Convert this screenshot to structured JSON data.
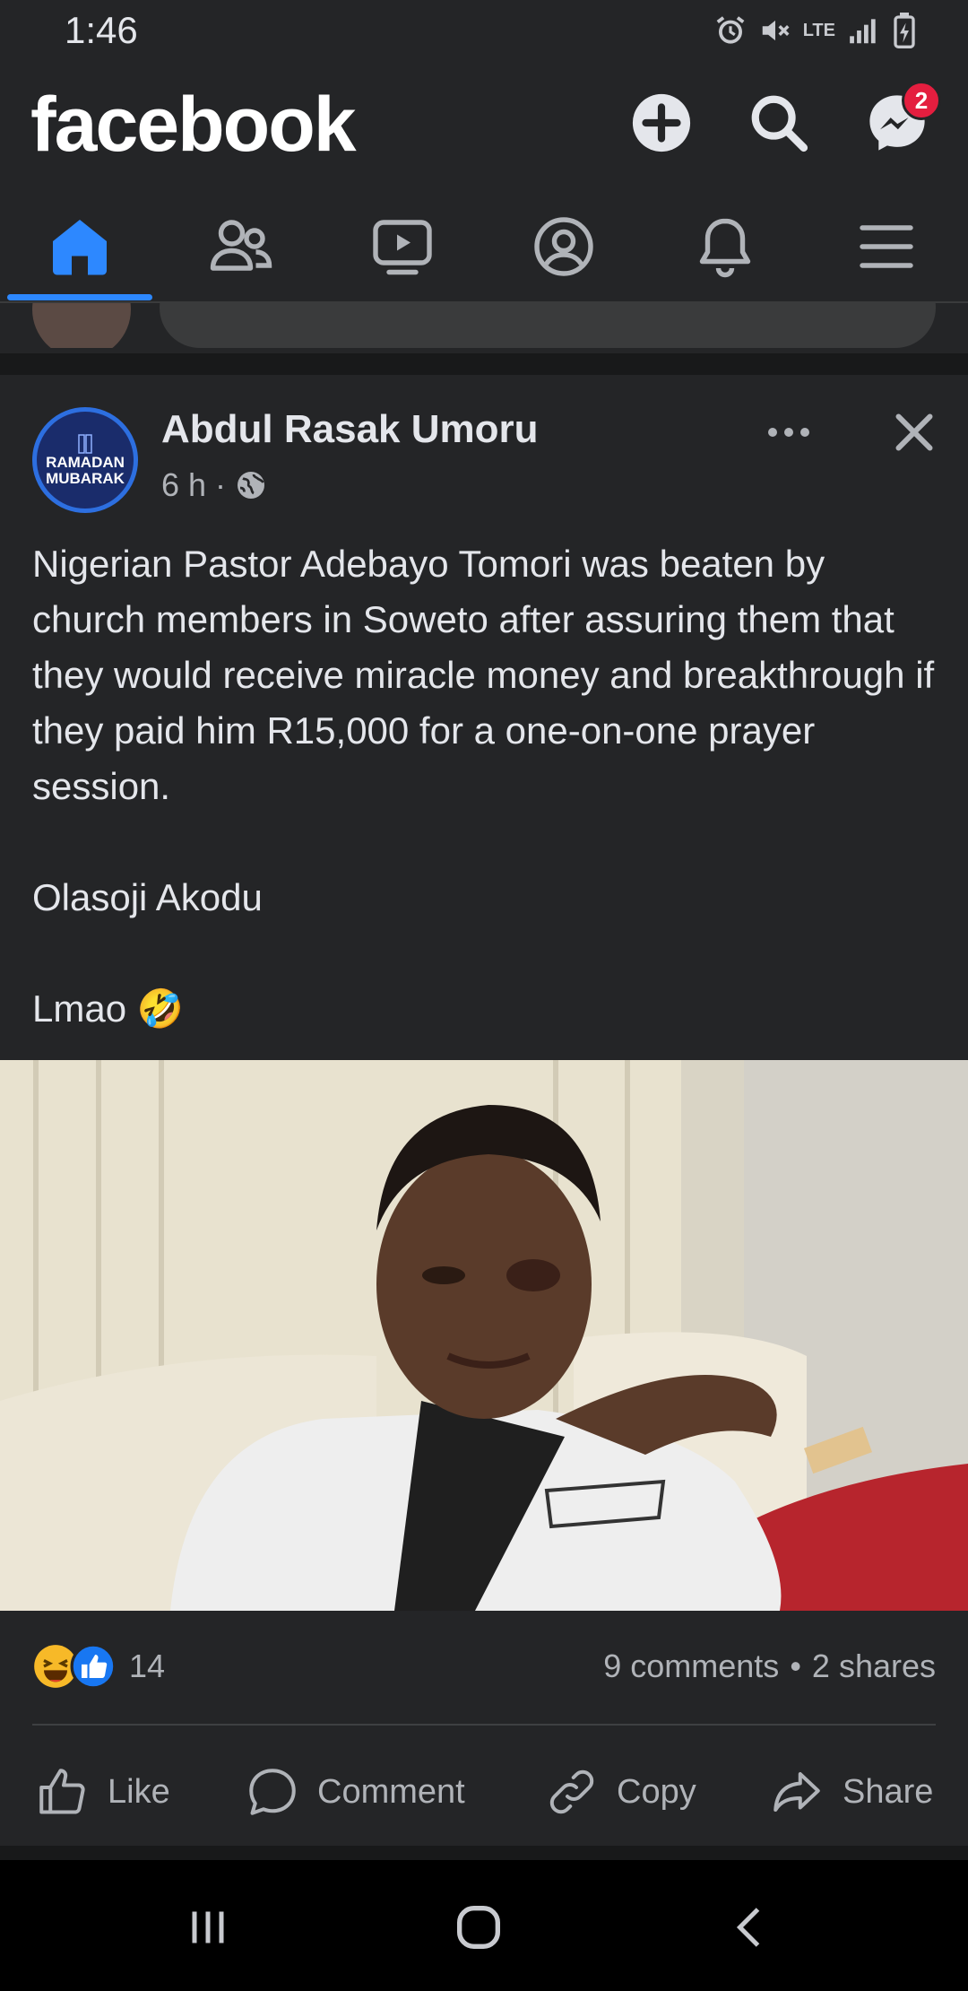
{
  "status_bar": {
    "time": "1:46",
    "network": "LTE"
  },
  "app": {
    "logo": "facebook",
    "messenger_badge": "2"
  },
  "nav_tabs": [
    {
      "name": "home",
      "icon": "home-icon",
      "active": true
    },
    {
      "name": "friends",
      "icon": "friends-icon",
      "active": false
    },
    {
      "name": "watch",
      "icon": "video-icon",
      "active": false
    },
    {
      "name": "profile",
      "icon": "profile-icon",
      "active": false
    },
    {
      "name": "notifications",
      "icon": "bell-icon",
      "active": false
    },
    {
      "name": "menu",
      "icon": "menu-icon",
      "active": false
    }
  ],
  "post": {
    "author": "Abdul Rasak Umoru",
    "avatar_text_1": "RAMADAN",
    "avatar_text_2": "MUBARAK",
    "time": "6 h",
    "separator": "·",
    "audience_icon": "globe-icon",
    "body_1": "Nigerian Pastor Adebayo Tomori was beaten by church members in Soweto after assuring them that they would receive miracle money and breakthrough if they paid him R15,000 for a one-on-one prayer session.",
    "body_2": "Olasoji Akodu",
    "body_3": "Lmao 🤣",
    "reaction_count": "14",
    "comments": "9 comments",
    "stats_separator": "•",
    "shares": "2 shares"
  },
  "actions": {
    "like": "Like",
    "comment": "Comment",
    "copy": "Copy",
    "share": "Share"
  },
  "colors": {
    "background": "#242527",
    "accent": "#2d88ff",
    "badge": "#e41e3f",
    "text_secondary": "#b0b3b8"
  }
}
